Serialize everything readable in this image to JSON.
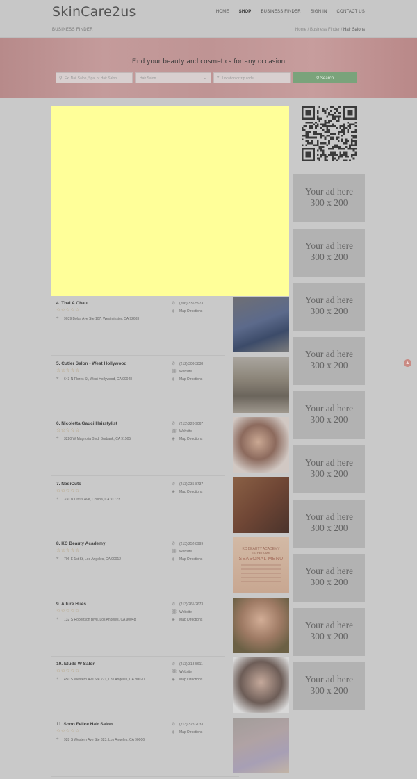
{
  "header": {
    "logo": "SkinCare2us",
    "nav": [
      {
        "label": "HOME"
      },
      {
        "label": "SHOP",
        "active": true
      },
      {
        "label": "BUSINESS FINDER"
      },
      {
        "label": "SIGN IN"
      },
      {
        "label": "CONTACT US"
      }
    ],
    "section_title": "BUSINESS FINDER",
    "breadcrumb": {
      "home": "Home",
      "sep": "/",
      "parent": "Business Finder",
      "current": "Hair Salons"
    }
  },
  "hero": {
    "title": "Find your beauty and cosmetics for any occasion",
    "keyword_placeholder": "Ex: Nail Salon, Spa, or Hair Salon",
    "category_value": "Hair Salon",
    "location_placeholder": "Location or zip code",
    "search_label": "Search"
  },
  "ads": {
    "line1": "Your ad here",
    "line2": "300 x 200"
  },
  "listings": [
    {
      "name": "4. Thai A Chau",
      "phone": "(206) 331-5973",
      "address": "9039 Bolsa Ave Ste 107, Westminster, CA 92683",
      "has_website": false
    },
    {
      "name": "5. Cutler Salon - West Hollywood",
      "phone": "(212) 308-3838",
      "address": "643 N Flores St, West Hollywood, CA 90048",
      "has_website": true
    },
    {
      "name": "6. Nicoletta Gauci Hairstylist",
      "phone": "(213) 220-9067",
      "address": "3220 W Magnolia Blvd, Burbank, CA 91505",
      "has_website": true
    },
    {
      "name": "7. NadiCuts",
      "phone": "(213) 235-8737",
      "address": "330 N Citrus Ave, Covina, CA 91723",
      "has_website": false
    },
    {
      "name": "8. KC Beauty Academy",
      "phone": "(213) 252-8999",
      "address": "706 E 1st St, Los Angeles, CA 90012",
      "has_website": true
    },
    {
      "name": "9. Allure Hues",
      "phone": "(213) 265-2673",
      "address": "132 S Robertson Blvd, Los Angeles, CA 90048",
      "has_website": true
    },
    {
      "name": "10. Etude W Salon",
      "phone": "(213) 318-5611",
      "address": "450 S Western Ave Ste 221, Los Angeles, CA 90020",
      "has_website": true
    },
    {
      "name": "11. Sono Felice Hair Salon",
      "phone": "(213) 322-2033",
      "address": "928 S Western Ave Ste 323, Los Angeles, CA 90006",
      "has_website": false
    }
  ],
  "labels": {
    "website": "Website",
    "directions": "Map Directions"
  },
  "menu_card": {
    "top": "KC BEAUTY ACADEMY",
    "mid": "ESTHETICIAN",
    "title": "SEASONAL MENU"
  },
  "colors": {
    "overlay": "#ffff99",
    "search_button": "#7aa37b",
    "scroll_top": "#c98b84"
  }
}
